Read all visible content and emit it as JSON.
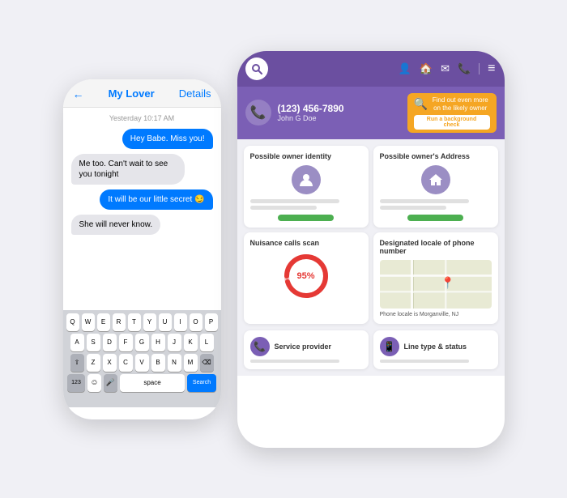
{
  "scene": {
    "bg_color": "#f0f0f5"
  },
  "left_phone": {
    "header": {
      "back": "←",
      "contact": "My Lover",
      "details": "Details"
    },
    "timestamp": "Yesterday 10:17 AM",
    "messages": [
      {
        "text": "Hey Babe. Miss you!",
        "type": "sent"
      },
      {
        "text": "Me too. Can't wait to see you tonight",
        "type": "received"
      },
      {
        "text": "It will be our little secret 😏",
        "type": "sent"
      },
      {
        "text": "She will never know.",
        "type": "received"
      }
    ],
    "keyboard": {
      "row1": [
        "Q",
        "W",
        "E",
        "R",
        "T",
        "Y",
        "U",
        "I",
        "O",
        "P"
      ],
      "row2": [
        "A",
        "S",
        "D",
        "F",
        "G",
        "H",
        "J",
        "K",
        "L"
      ],
      "row3": [
        "Z",
        "X",
        "C",
        "V",
        "B",
        "N",
        "M"
      ],
      "bottom": [
        "123",
        "😊",
        "🎤",
        "space",
        "Search"
      ]
    }
  },
  "right_phone": {
    "header": {
      "logo": "🔍",
      "icons": [
        "👤",
        "🏠",
        "✉",
        "📞"
      ],
      "menu": "≡"
    },
    "caller": {
      "number": "(123) 456-7890",
      "name": "John G Doe",
      "phone_icon": "📞"
    },
    "bg_check": {
      "emoji": "🔍",
      "text": "Find out even more on the likely owner",
      "button": "Run a background check"
    },
    "cards": [
      {
        "id": "owner-identity",
        "title": "Possible owner identity",
        "icon": "person",
        "has_green_btn": true
      },
      {
        "id": "owner-address",
        "title": "Possible owner's Address",
        "icon": "house",
        "has_green_btn": true
      },
      {
        "id": "nuisance-calls",
        "title": "Nuisance calls scan",
        "percent": 95,
        "percent_label": "95%"
      },
      {
        "id": "locale",
        "title": "Designated locale of phone number",
        "map_caption": "Phone locale is Morganville, NJ"
      }
    ],
    "bottom_cards": [
      {
        "id": "service-provider",
        "title": "Service provider",
        "icon": "📞"
      },
      {
        "id": "line-type",
        "title": "Line type & status",
        "icon": "📱"
      }
    ]
  }
}
